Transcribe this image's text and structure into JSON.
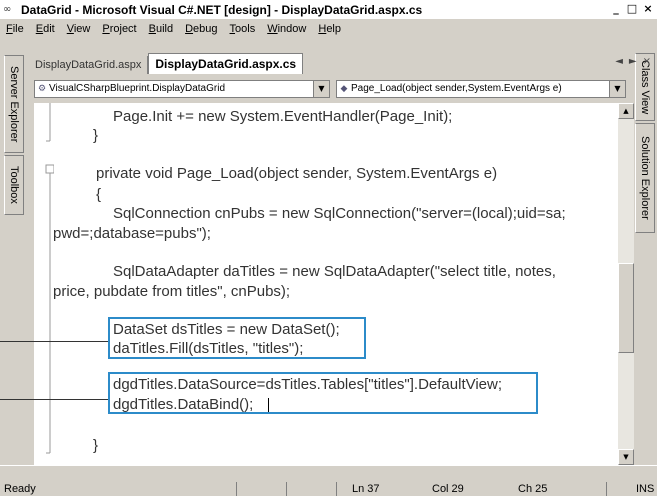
{
  "window": {
    "title": "DataGrid - Microsoft Visual C#.NET [design] - DisplayDataGrid.aspx.cs",
    "app_icon": "vs-logo-icon",
    "controls": [
      "_",
      "□",
      "×"
    ]
  },
  "menu": [
    "File",
    "Edit",
    "View",
    "Project",
    "Build",
    "Debug",
    "Tools",
    "Window",
    "Help"
  ],
  "left_dock": [
    "Server Explorer",
    "Toolbox"
  ],
  "right_dock": [
    "Class View",
    "Solution Explorer"
  ],
  "tabs": [
    {
      "label": "DisplayDataGrid.aspx",
      "active": false
    },
    {
      "label": "DisplayDataGrid.aspx.cs",
      "active": true
    }
  ],
  "tab_nav": {
    "prev": "◄",
    "next": "►",
    "close": "×"
  },
  "class_combo": {
    "value": "VisualCSharpBlueprint.DisplayDataGrid",
    "icon": "class-icon"
  },
  "method_combo": {
    "value": "Page_Load(object sender,System.EventArgs e)",
    "icon": "method-icon"
  },
  "code_lines": [
    "Page.Init += new System.EventHandler(Page_Init);",
    "}",
    "private void Page_Load(object sender, System.EventArgs e)",
    "{",
    "SqlConnection cnPubs = new SqlConnection(\"server=(local);uid=sa;",
    "pwd=;database=pubs\");",
    "SqlDataAdapter daTitles = new SqlDataAdapter(\"select title, notes,",
    "price, pubdate from titles\", cnPubs);",
    "DataSet dsTitles = new DataSet();",
    "daTitles.Fill(dsTitles, \"titles\");",
    "dgdTitles.DataSource=dsTitles.Tables[\"titles\"].DefaultView;",
    "dgdTitles.DataBind();",
    "}"
  ],
  "status": {
    "ready": "Ready",
    "line": "Ln 37",
    "col": "Col 29",
    "ch": "Ch 25",
    "mode": "INS"
  }
}
